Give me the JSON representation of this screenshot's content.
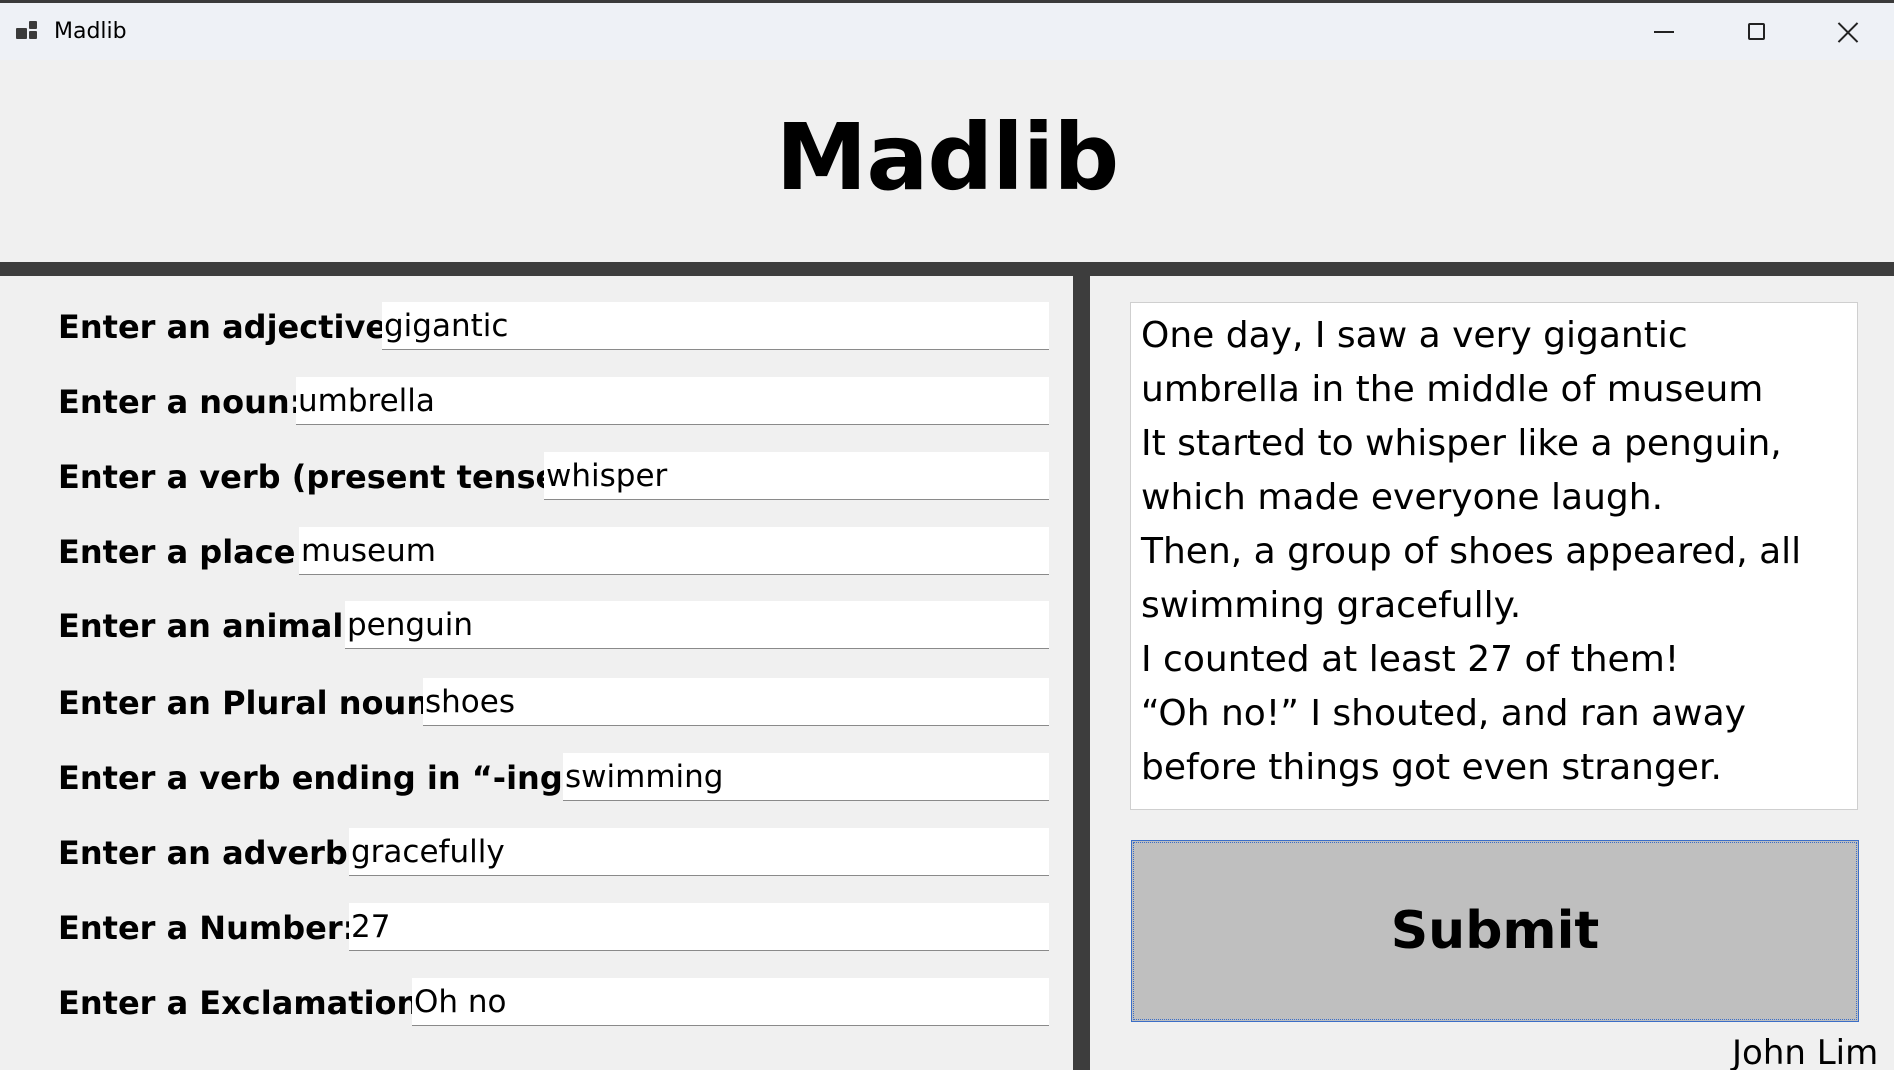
{
  "window": {
    "title": "Madlib",
    "icon": "app-window-icon",
    "controls": [
      "minimize-icon",
      "maximize-icon",
      "close-icon"
    ]
  },
  "header": {
    "title": "Madlib"
  },
  "form": {
    "fields": [
      {
        "label": "Enter an adjective:",
        "value": "gigantic"
      },
      {
        "label": "Enter a noun:",
        "value": "umbrella"
      },
      {
        "label": "Enter a verb (present tense):",
        "value": "whisper"
      },
      {
        "label": "Enter a place:",
        "value": "museum"
      },
      {
        "label": "Enter an animal:",
        "value": "penguin"
      },
      {
        "label": "Enter an Plural noun:",
        "value": "shoes"
      },
      {
        "label": "Enter a verb ending in “-ing”:",
        "value": "swimming"
      },
      {
        "label": "Enter an adverb:",
        "value": "gracefully"
      },
      {
        "label": "Enter a Number:",
        "value": "27"
      },
      {
        "label": "Enter a Exclamation:",
        "value": "Oh no"
      }
    ]
  },
  "story": {
    "lines": [
      "One day, I saw a very gigantic",
      "umbrella in the middle of museum",
      "It started to whisper like a penguin,",
      "which made everyone laugh.",
      "Then, a group of shoes appeared, all",
      "swimming gracefully.",
      "I counted at least 27 of them!",
      "“Oh no!” I shouted, and ran away",
      "before things got even stranger."
    ]
  },
  "submit": {
    "label": "Submit"
  },
  "footer": {
    "author": "John Lim"
  },
  "colors": {
    "background": "#f0f0f0",
    "divider": "#3d3d3d",
    "button": "#bfbfbf",
    "focus_border": "#3b6ec7"
  }
}
